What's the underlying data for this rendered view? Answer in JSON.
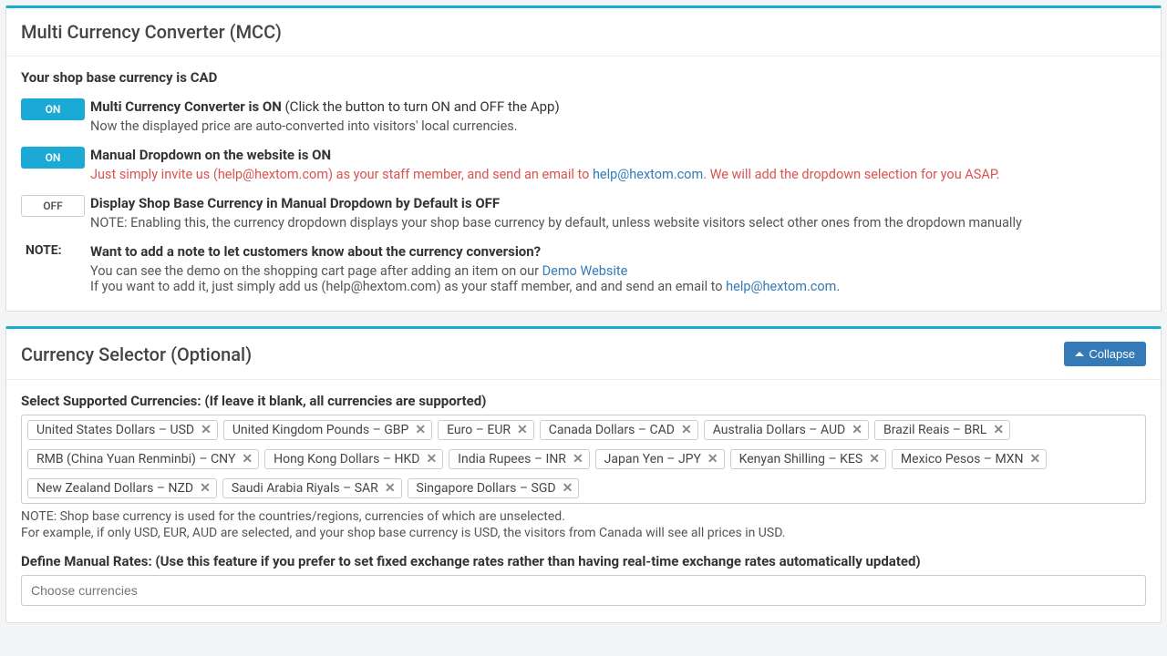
{
  "panel1": {
    "title": "Multi Currency Converter (MCC)",
    "base_currency_line": "Your shop base currency is CAD",
    "settings": [
      {
        "toggle": "ON",
        "on": true,
        "title_bold": "Multi Currency Converter is ON",
        "title_rest": " (Click the button to turn ON and OFF the App)",
        "sub_plain": "Now the displayed price are auto-converted into visitors' local currencies.",
        "sub_red_pre": "",
        "sub_link": "",
        "sub_red_post": ""
      },
      {
        "toggle": "ON",
        "on": true,
        "title_bold": "Manual Dropdown on the website is ON",
        "title_rest": "",
        "sub_plain": "",
        "sub_red_pre": "Just simply invite us (help@hextom.com) as your staff member, and send an email to ",
        "sub_link": "help@hextom.com",
        "sub_red_post": ". We will add the dropdown selection for you ASAP."
      },
      {
        "toggle": "OFF",
        "on": false,
        "title_bold": "Display Shop Base Currency in Manual Dropdown by Default is OFF",
        "title_rest": "",
        "sub_plain": "NOTE: Enabling this, the currency dropdown displays your shop base currency by default, unless website visitors select other ones from the dropdown manually",
        "sub_red_pre": "",
        "sub_link": "",
        "sub_red_post": ""
      }
    ],
    "note_label": "NOTE:",
    "note_title": "Want to add a note to let customers know about the currency conversion?",
    "note_line1_pre": "You can see the demo on the shopping cart page after adding an item on our ",
    "note_line1_link": "Demo Website",
    "note_line2_pre": "If you want to add it, just simply add us (help@hextom.com) as your staff member, and and send an email to ",
    "note_line2_link": "help@hextom.com",
    "note_line2_post": "."
  },
  "panel2": {
    "title": "Currency Selector (Optional)",
    "collapse_label": "Collapse",
    "supported_label": "Select Supported Currencies: (If leave it blank, all currencies are supported)",
    "currencies": [
      "United States Dollars – USD",
      "United Kingdom Pounds – GBP",
      "Euro – EUR",
      "Canada Dollars – CAD",
      "Australia Dollars – AUD",
      "Brazil Reais – BRL",
      "RMB (China Yuan Renminbi) – CNY",
      "Hong Kong Dollars – HKD",
      "India Rupees – INR",
      "Japan Yen – JPY",
      "Kenyan Shilling – KES",
      "Mexico Pesos – MXN",
      "New Zealand Dollars – NZD",
      "Saudi Arabia Riyals – SAR",
      "Singapore Dollars – SGD"
    ],
    "note1": "NOTE: Shop base currency is used for the countries/regions, currencies of which are unselected.",
    "note2": "For example, if only USD, EUR, AUD are selected, and your shop base currency is USD, the visitors from Canada will see all prices in USD.",
    "manual_rates_label": "Define Manual Rates: (Use this feature if you prefer to set fixed exchange rates rather than having real-time exchange rates automatically updated)",
    "manual_rates_placeholder": "Choose currencies"
  }
}
